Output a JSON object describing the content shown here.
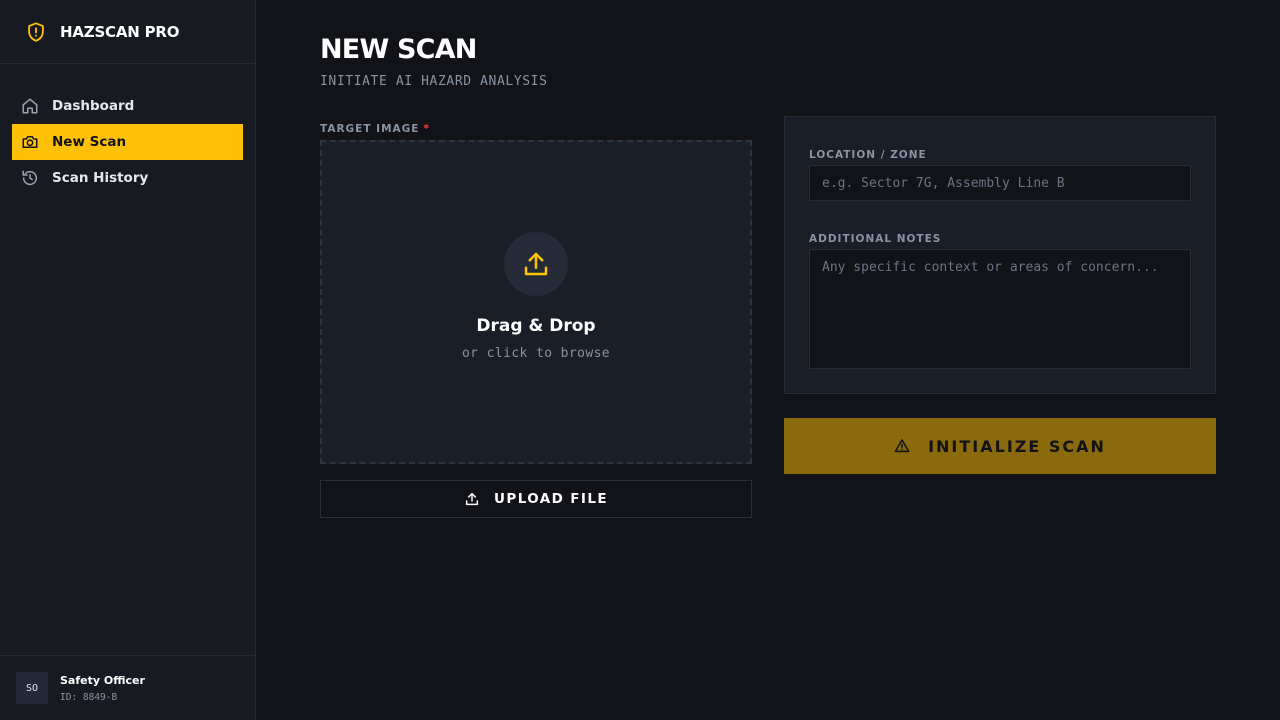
{
  "brand": {
    "name": "HAZSCAN PRO",
    "icon": "shield-alert-icon"
  },
  "sidebar": {
    "items": [
      {
        "label": "Dashboard",
        "icon": "home-icon",
        "active": false
      },
      {
        "label": "New Scan",
        "icon": "camera-icon",
        "active": true
      },
      {
        "label": "Scan History",
        "icon": "history-icon",
        "active": false
      }
    ]
  },
  "user": {
    "initials": "SO",
    "name": "Safety Officer",
    "id": "ID: 8849-B"
  },
  "page": {
    "title": "NEW SCAN",
    "subtitle": "INITIATE AI HAZARD ANALYSIS"
  },
  "upload": {
    "label": "TARGET IMAGE",
    "required_mark": "*",
    "drop_title": "Drag & Drop",
    "drop_sub": "or click to browse",
    "button_label": "UPLOAD FILE"
  },
  "form": {
    "location_label": "LOCATION / ZONE",
    "location_placeholder": "e.g. Sector 7G, Assembly Line B",
    "notes_label": "ADDITIONAL NOTES",
    "notes_placeholder": "Any specific context or areas of concern..."
  },
  "action": {
    "scan_label": "INITIALIZE SCAN",
    "icon": "warning-triangle-icon"
  },
  "colors": {
    "accent": "#ffc107",
    "accent_muted": "#8a6a0c",
    "background": "#111318",
    "panel": "#1a1e26",
    "required": "#ef4444"
  }
}
